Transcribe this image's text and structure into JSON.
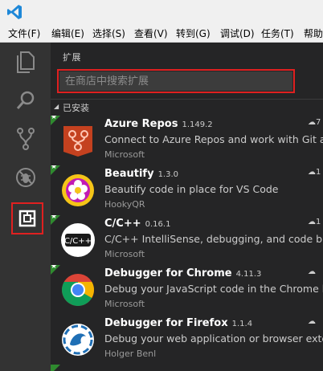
{
  "menu": [
    {
      "label": "文件(F)"
    },
    {
      "label": "编辑(E)"
    },
    {
      "label": "选择(S)"
    },
    {
      "label": "查看(V)"
    },
    {
      "label": "转到(G)"
    },
    {
      "label": "调试(D)"
    },
    {
      "label": "任务(T)"
    },
    {
      "label": "帮助"
    }
  ],
  "sidebar": {
    "title": "扩展",
    "search_placeholder": "在商店中搜索扩展",
    "section_label": "已安装"
  },
  "extensions": [
    {
      "name": "Azure Repos",
      "version": "1.149.2",
      "description": "Connect to Azure Repos and work with Git and",
      "publisher": "Microsoft",
      "downloads": "7",
      "icon": "azure-repos-icon",
      "color": "#c4411f"
    },
    {
      "name": "Beautify",
      "version": "1.3.0",
      "description": "Beautify code in place for VS Code",
      "publisher": "HookyQR",
      "downloads": "1",
      "icon": "beautify-icon",
      "color": "#f5c518"
    },
    {
      "name": "C/C++",
      "version": "0.16.1",
      "description": "C/C++ IntelliSense, debugging, and code brows",
      "publisher": "Microsoft",
      "downloads": "1",
      "icon": "cpp-icon",
      "color": "#ffffff"
    },
    {
      "name": "Debugger for Chrome",
      "version": "4.11.3",
      "description": "Debug your JavaScript code in the Chrome brov",
      "publisher": "Microsoft",
      "downloads": "",
      "icon": "chrome-icon",
      "color": "#db4437"
    },
    {
      "name": "Debugger for Firefox",
      "version": "1.1.4",
      "description": "Debug your web application or browser extensi",
      "publisher": "Holger Benl",
      "downloads": "",
      "icon": "firefox-icon",
      "color": "#1f6fb5"
    }
  ]
}
